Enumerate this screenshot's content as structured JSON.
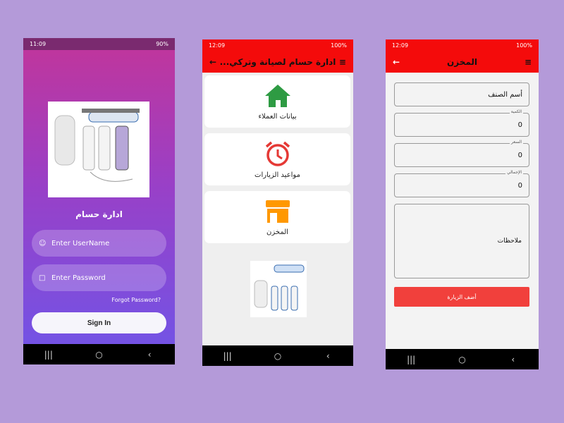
{
  "login": {
    "status": {
      "time": "11:09",
      "right": "90%"
    },
    "app_name": "ادارة حسام",
    "username_placeholder": "Enter UserName",
    "password_placeholder": "Enter Password",
    "forgot": "Forgot Password?",
    "signin": "Sign In",
    "product_image": "ro-water-filter-image"
  },
  "menu": {
    "status": {
      "time": "12:09",
      "right": "100%"
    },
    "title": "...ادارة حسام لصيانة وتركي",
    "cards": [
      {
        "label": "بيانات العملاء",
        "icon": "home-icon",
        "color": "#2e9b43"
      },
      {
        "label": "مواعيد الزيارات",
        "icon": "alarm-clock-icon",
        "color": "#e53935"
      },
      {
        "label": "المخزن",
        "icon": "store-icon",
        "color": "#ff9800"
      }
    ],
    "product_image": "ro-water-filter-image"
  },
  "store": {
    "status": {
      "time": "12:09",
      "right": "100%"
    },
    "title": "المخزن",
    "item_name_placeholder": "أسم الصنف",
    "fields": [
      {
        "label": "الكمية",
        "value": "0"
      },
      {
        "label": "السعر",
        "value": "0"
      },
      {
        "label": "الإجمالي",
        "value": "0"
      }
    ],
    "notes": "ملاحظات",
    "add_button": "أضف الزيارة"
  },
  "colors": {
    "accent_red": "#f40b0b",
    "button_red": "#f1403c",
    "background": "#b49ad9"
  }
}
